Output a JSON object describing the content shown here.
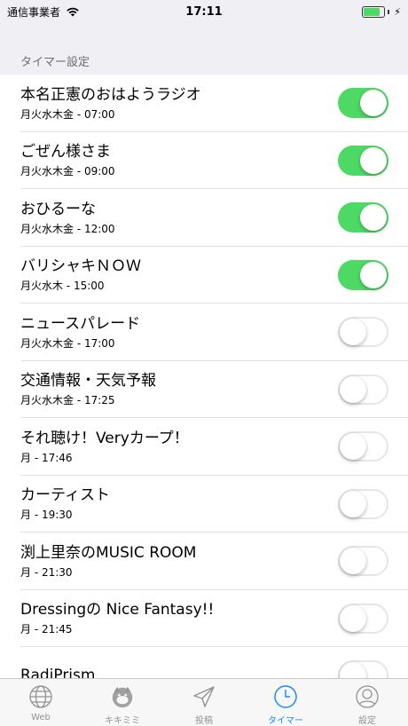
{
  "status_bar": {
    "carrier": "通信事業者",
    "time": "17:11"
  },
  "section_header": "タイマー設定",
  "colors": {
    "switch_on": "#4cd964",
    "tab_active": "#1a8cff",
    "tab_inactive": "#929292"
  },
  "timers": [
    {
      "title": "本名正憲のおはようラジオ",
      "schedule": "月火水木金 - 07:00",
      "enabled": true
    },
    {
      "title": "ごぜん様さま",
      "schedule": "月火水木金 - 09:00",
      "enabled": true
    },
    {
      "title": "おひるーな",
      "schedule": "月火水木金 - 12:00",
      "enabled": true
    },
    {
      "title": "バリシャキＮＯＷ",
      "schedule": "月火水木 - 15:00",
      "enabled": true
    },
    {
      "title": "ニュースパレード",
      "schedule": "月火水木金 - 17:00",
      "enabled": false
    },
    {
      "title": "交通情報・天気予報",
      "schedule": "月火水木金 - 17:25",
      "enabled": false
    },
    {
      "title": "それ聴け！Veryカープ！",
      "schedule": "月 - 17:46",
      "enabled": false
    },
    {
      "title": "カーティスト",
      "schedule": "月 - 19:30",
      "enabled": false
    },
    {
      "title": "渕上里奈のMUSIC ROOM",
      "schedule": "月 - 21:30",
      "enabled": false
    },
    {
      "title": "Dressingの Nice Fantasy!!",
      "schedule": "月 - 21:45",
      "enabled": false
    },
    {
      "title": "RadiPrism",
      "schedule": "",
      "enabled": false
    }
  ],
  "tab_bar": {
    "tabs": [
      {
        "label": "Web",
        "icon": "globe-icon",
        "active": false
      },
      {
        "label": "キキミミ",
        "icon": "kikimimi-character-icon",
        "active": false
      },
      {
        "label": "投稿",
        "icon": "paper-plane-icon",
        "active": false
      },
      {
        "label": "タイマー",
        "icon": "clock-icon",
        "active": true
      },
      {
        "label": "設定",
        "icon": "person-icon",
        "active": false
      }
    ]
  }
}
